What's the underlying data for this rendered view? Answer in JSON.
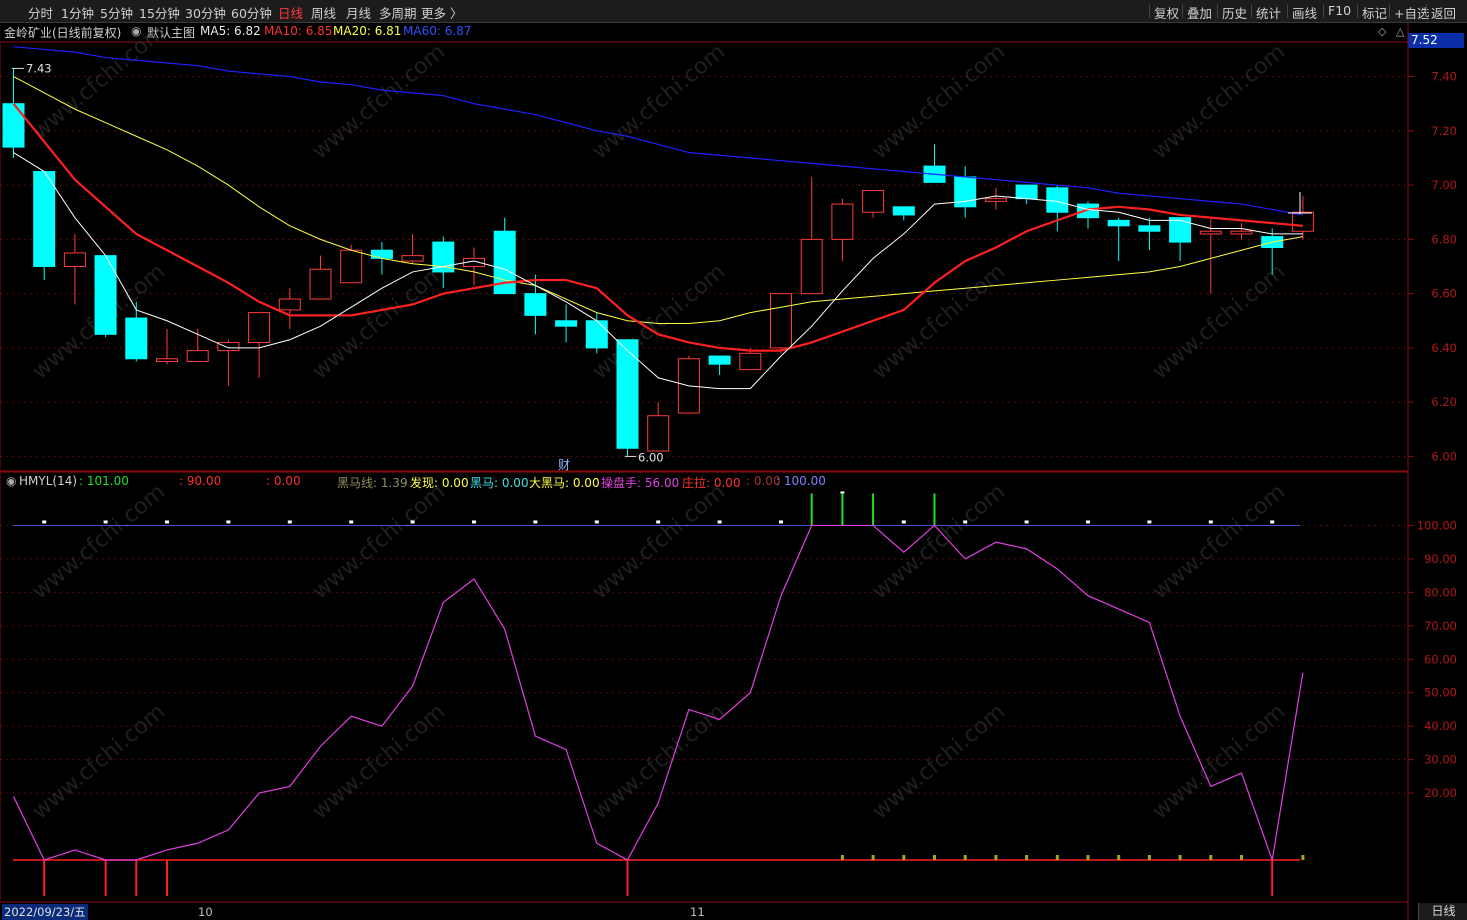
{
  "toolbar": {
    "periods": [
      "分时",
      "1分钟",
      "5分钟",
      "15分钟",
      "30分钟",
      "60分钟",
      "日线",
      "周线",
      "月线",
      "多周期",
      "更多 〉"
    ],
    "active_period": "日线",
    "right_buttons": [
      "复权",
      "叠加",
      "历史",
      "统计",
      "画线",
      "F10",
      "标记",
      "+自选",
      "返回"
    ]
  },
  "header": {
    "stock": "金岭矿业(日线前复权)",
    "template": "默认主图",
    "ma5": "MA5: 6.82",
    "ma10": "MA10: 6.85",
    "ma20": "MA20: 6.81",
    "ma60": "MA60: 6.87",
    "current_price": "7.52"
  },
  "indicator_header": {
    "name": "HMYL(14)",
    "v1": ": 101.00",
    "v2": ": 90.00",
    "v3": ": 0.00",
    "heima_line": "黑马线: 1.39",
    "faxian": "发现: 0.00",
    "heima": "黑马: 0.00",
    "daheima": "大黑马: 0.00",
    "caopanshou": "操盘手: 56.00",
    "zhuangla": "庄拉: 0.00",
    "v4": ": 0.00",
    "v5": ": 100.00"
  },
  "colors": {
    "up": "#ff3b3b",
    "down": "#00ffff",
    "ma5": "#ffffff",
    "ma10": "#ff2020",
    "ma20": "#ffff40",
    "ma60": "#2020ff",
    "osc": "#e040e0",
    "axis": "#a01010"
  },
  "chart_data": [
    {
      "type": "candlestick",
      "title": "金岭矿业(日线前复权)",
      "ylim": [
        5.95,
        7.52
      ],
      "yticks": [
        6.0,
        6.2,
        6.4,
        6.6,
        6.8,
        7.0,
        7.2,
        7.4
      ],
      "high_label": "7.43",
      "low_label": "6.00",
      "marker": "财",
      "candles": [
        [
          7.3,
          7.14,
          7.43,
          7.1
        ],
        [
          7.05,
          6.7,
          7.05,
          6.65
        ],
        [
          6.7,
          6.75,
          6.82,
          6.56
        ],
        [
          6.74,
          6.45,
          6.74,
          6.44
        ],
        [
          6.51,
          6.36,
          6.57,
          6.35
        ],
        [
          6.35,
          6.36,
          6.47,
          6.34
        ],
        [
          6.35,
          6.39,
          6.47,
          6.35
        ],
        [
          6.39,
          6.42,
          6.43,
          6.26
        ],
        [
          6.42,
          6.53,
          6.53,
          6.29
        ],
        [
          6.54,
          6.58,
          6.62,
          6.47
        ],
        [
          6.58,
          6.69,
          6.74,
          6.58
        ],
        [
          6.64,
          6.76,
          6.78,
          6.65
        ],
        [
          6.76,
          6.73,
          6.79,
          6.67
        ],
        [
          6.72,
          6.74,
          6.82,
          6.71
        ],
        [
          6.79,
          6.68,
          6.81,
          6.62
        ],
        [
          6.7,
          6.73,
          6.77,
          6.63
        ],
        [
          6.83,
          6.6,
          6.88,
          6.6
        ],
        [
          6.6,
          6.52,
          6.67,
          6.45
        ],
        [
          6.5,
          6.48,
          6.56,
          6.42
        ],
        [
          6.5,
          6.4,
          6.53,
          6.38
        ],
        [
          6.43,
          6.03,
          6.43,
          6.0
        ],
        [
          6.02,
          6.15,
          6.2,
          6.02
        ],
        [
          6.16,
          6.36,
          6.37,
          6.16
        ],
        [
          6.37,
          6.34,
          6.37,
          6.3
        ],
        [
          6.32,
          6.38,
          6.4,
          6.32
        ],
        [
          6.4,
          6.6,
          6.6,
          6.38
        ],
        [
          6.6,
          6.8,
          7.03,
          6.6
        ],
        [
          6.8,
          6.93,
          6.95,
          6.72
        ],
        [
          6.9,
          6.98,
          6.98,
          6.88
        ],
        [
          6.92,
          6.89,
          6.92,
          6.87
        ],
        [
          7.07,
          7.01,
          7.15,
          7.01
        ],
        [
          7.03,
          6.92,
          7.07,
          6.88
        ],
        [
          6.94,
          6.95,
          6.99,
          6.91
        ],
        [
          7.0,
          6.95,
          7.0,
          6.93
        ],
        [
          6.99,
          6.9,
          7.0,
          6.83
        ],
        [
          6.93,
          6.88,
          6.94,
          6.84
        ],
        [
          6.87,
          6.85,
          6.88,
          6.72
        ],
        [
          6.85,
          6.83,
          6.88,
          6.76
        ],
        [
          6.88,
          6.79,
          6.88,
          6.72
        ],
        [
          6.82,
          6.83,
          6.88,
          6.6
        ],
        [
          6.82,
          6.83,
          6.86,
          6.8
        ],
        [
          6.81,
          6.77,
          6.84,
          6.67
        ],
        [
          6.83,
          6.9,
          6.96,
          6.8
        ]
      ],
      "ma5": [
        7.12,
        7.05,
        6.88,
        6.74,
        6.54,
        6.5,
        6.45,
        6.4,
        6.4,
        6.43,
        6.48,
        6.55,
        6.62,
        6.68,
        6.7,
        6.72,
        6.69,
        6.63,
        6.57,
        6.5,
        6.39,
        6.29,
        6.26,
        6.25,
        6.25,
        6.37,
        6.48,
        6.61,
        6.73,
        6.82,
        6.93,
        6.94,
        6.96,
        6.95,
        6.94,
        6.91,
        6.9,
        6.87,
        6.87,
        6.84,
        6.84,
        6.82,
        6.82
      ],
      "ma10": [
        7.3,
        7.16,
        7.02,
        6.92,
        6.82,
        6.76,
        6.7,
        6.64,
        6.57,
        6.52,
        6.52,
        6.52,
        6.54,
        6.56,
        6.6,
        6.62,
        6.64,
        6.65,
        6.65,
        6.62,
        6.52,
        6.45,
        6.42,
        6.4,
        6.39,
        6.39,
        6.42,
        6.46,
        6.5,
        6.54,
        6.64,
        6.72,
        6.77,
        6.83,
        6.87,
        6.91,
        6.92,
        6.91,
        6.89,
        6.88,
        6.87,
        6.86,
        6.85
      ],
      "ma20": [
        7.4,
        7.34,
        7.28,
        7.23,
        7.18,
        7.13,
        7.07,
        7.0,
        6.92,
        6.85,
        6.8,
        6.76,
        6.73,
        6.71,
        6.7,
        6.68,
        6.65,
        6.63,
        6.58,
        6.53,
        6.5,
        6.49,
        6.49,
        6.5,
        6.53,
        6.55,
        6.57,
        6.58,
        6.59,
        6.6,
        6.61,
        6.62,
        6.63,
        6.64,
        6.65,
        6.66,
        6.67,
        6.68,
        6.7,
        6.73,
        6.76,
        6.79,
        6.81
      ],
      "ma60": [
        7.51,
        7.5,
        7.49,
        7.47,
        7.46,
        7.45,
        7.44,
        7.42,
        7.41,
        7.4,
        7.38,
        7.37,
        7.35,
        7.34,
        7.33,
        7.3,
        7.28,
        7.26,
        7.23,
        7.2,
        7.18,
        7.15,
        7.12,
        7.11,
        7.1,
        7.09,
        7.08,
        7.07,
        7.06,
        7.05,
        7.04,
        7.03,
        7.02,
        7.01,
        7.0,
        6.99,
        6.97,
        6.96,
        6.95,
        6.94,
        6.93,
        6.91,
        6.89
      ]
    },
    {
      "type": "line",
      "title": "HMYL(14)",
      "ylim": [
        0,
        110
      ],
      "yticks": [
        20,
        30,
        40,
        50,
        60,
        70,
        80,
        90,
        100
      ],
      "oscillator": [
        19,
        0,
        3,
        0,
        0,
        3,
        5,
        9,
        20,
        22,
        34,
        43,
        40,
        52,
        77,
        84,
        69,
        37,
        33,
        5,
        0,
        17,
        45,
        42,
        50,
        79,
        100,
        100,
        100,
        92,
        100,
        90,
        95,
        93,
        87,
        79,
        75,
        71,
        43,
        22,
        26,
        0,
        56
      ],
      "limit_line": 101,
      "red_spikes_index": [
        1,
        3,
        4,
        5,
        20,
        41
      ],
      "green_bars_index": [
        26,
        27,
        28,
        30
      ],
      "dots_index": [
        1,
        3,
        5,
        7,
        9,
        11,
        13,
        15,
        17,
        19,
        21,
        23,
        25,
        29,
        31,
        33,
        35,
        37,
        39,
        41
      ],
      "mini_bars_index": [
        27,
        28,
        29,
        30,
        31,
        32,
        33,
        34,
        35,
        36,
        37,
        38,
        39,
        40,
        42
      ]
    }
  ],
  "xaxis": {
    "date": "2022/09/23/五",
    "month_10": "10",
    "month_11": "11"
  },
  "bottom_tab": "日线",
  "watermark": "www.cfchi.com"
}
